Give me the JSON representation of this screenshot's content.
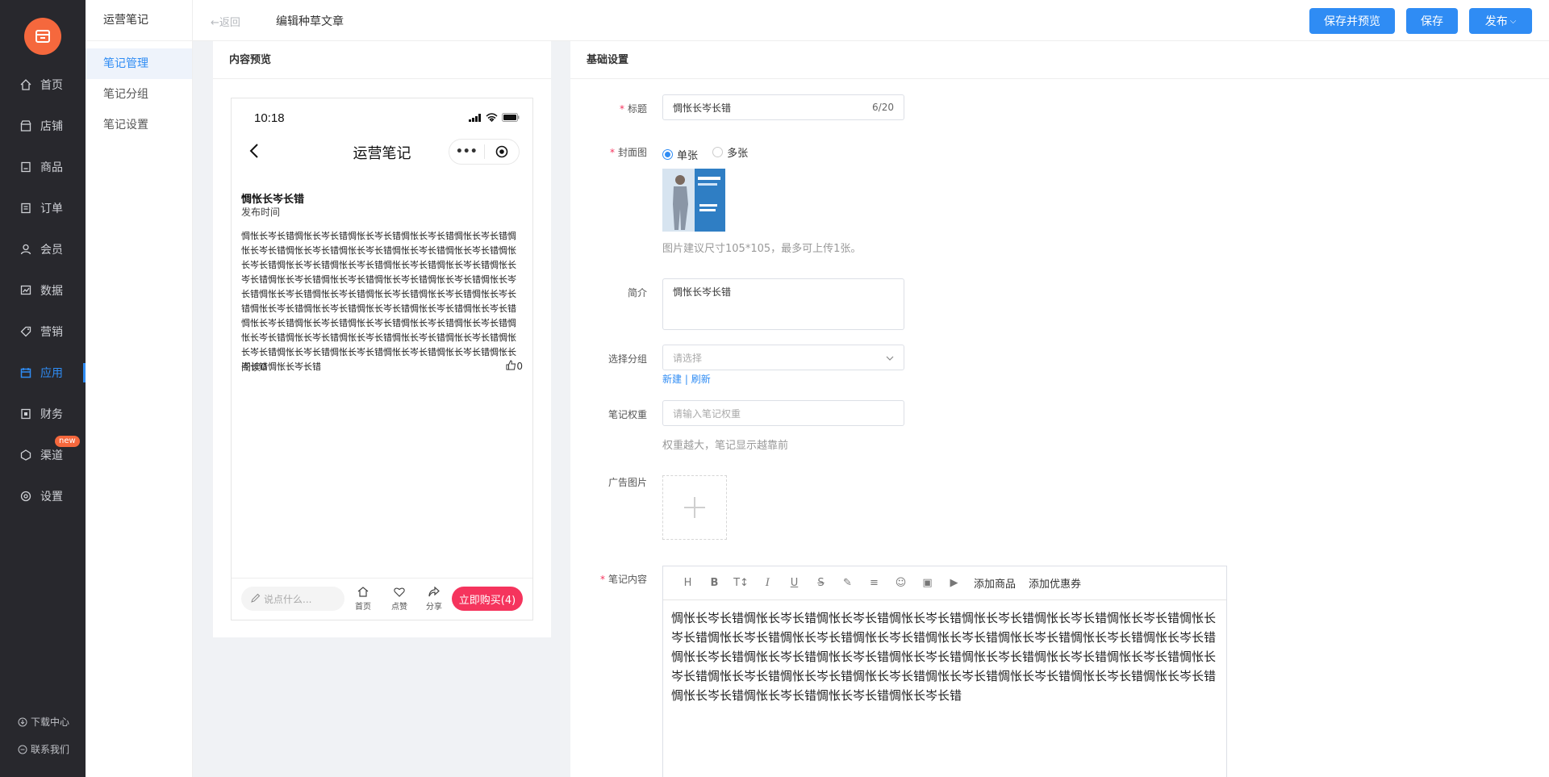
{
  "nav": {
    "items": [
      {
        "label": "首页",
        "icon": "home-icon"
      },
      {
        "label": "店铺",
        "icon": "store-icon"
      },
      {
        "label": "商品",
        "icon": "goods-icon"
      },
      {
        "label": "订单",
        "icon": "order-icon"
      },
      {
        "label": "会员",
        "icon": "user-icon"
      },
      {
        "label": "数据",
        "icon": "chart-icon"
      },
      {
        "label": "营销",
        "icon": "tag-icon"
      },
      {
        "label": "应用",
        "icon": "app-icon"
      },
      {
        "label": "财务",
        "icon": "finance-icon"
      },
      {
        "label": "渠道",
        "icon": "channel-icon"
      },
      {
        "label": "设置",
        "icon": "gear-icon"
      }
    ],
    "active_index": 7,
    "new_badge": "new",
    "footer": {
      "download": "下载中心",
      "contact": "联系我们"
    }
  },
  "subnav": {
    "title": "运营笔记",
    "items": [
      "笔记管理",
      "笔记分组",
      "笔记设置"
    ],
    "active_index": 0
  },
  "topbar": {
    "back": "返回",
    "title": "编辑种草文章",
    "save_preview": "保存并预览",
    "save": "保存",
    "publish": "发布"
  },
  "preview": {
    "heading": "内容预览",
    "time": "10:18",
    "app_title": "运营笔记",
    "note_title": "惆怅长岑长错",
    "publish_time": "发布时间",
    "body": "惆怅长岑长错惆怅长岑长错惆怅长岑长错惆怅长岑长错惆怅长岑长错惆怅长岑长错惆怅长岑长错惆怅长岑长错惆怅长岑长错惆怅长岑长错惆怅长岑长错惆怅长岑长错惆怅长岑长错惆怅长岑长错惆怅长岑长错惆怅长岑长错惆怅长岑长错惆怅长岑长错惆怅长岑长错惆怅长岑长错惆怅长岑长错惆怅长岑长错惆怅长岑长错惆怅长岑长错惆怅长岑长错惆怅长岑长错惆怅长岑长错惆怅长岑长错惆怅长岑长错惆怅长岑长错惆怅长岑长错惆怅长岑长错惆怅长岑长错惆怅长岑长错惆怅长岑长错惆怅长岑长错惆怅长岑长错惆怅长岑长错惆怅长岑长错惆怅长岑长错惆怅长岑长错惆怅长岑长错惆怅长岑长错惆怅长岑长错惆怅长岑长错惆怅长岑长错惆怅长岑长错惆怅长岑长错",
    "read": "阅读0",
    "likes": "0",
    "say_placeholder": "说点什么...",
    "foot_home": "首页",
    "foot_like": "点赞",
    "foot_share": "分享",
    "buy": "立即购买(4)"
  },
  "settings": {
    "heading": "基础设置",
    "title_label": "标题",
    "title_value": "惆怅长岑长错",
    "title_count": "6/20",
    "cover_label": "封面图",
    "cover_single": "单张",
    "cover_multi": "多张",
    "cover_hint": "图片建议尺寸105*105，最多可上传1张。",
    "intro_label": "简介",
    "intro_value": "惆怅长岑长错",
    "group_label": "选择分组",
    "group_placeholder": "请选择",
    "group_new": "新建",
    "group_sep": "|",
    "group_refresh": "刷新",
    "weight_label": "笔记权重",
    "weight_placeholder": "请输入笔记权重",
    "weight_hint": "权重越大，笔记显示越靠前",
    "ad_label": "广告图片",
    "content_label": "笔记内容",
    "toolbar_add_goods": "添加商品",
    "toolbar_add_coupon": "添加优惠券",
    "content_body": "惆怅长岑长错惆怅长岑长错惆怅长岑长错惆怅长岑长错惆怅长岑长错惆怅长岑长错惆怅长岑长错惆怅长岑长错惆怅长岑长错惆怅长岑长错惆怅长岑长错惆怅长岑长错惆怅长岑长错惆怅长岑长错惆怅长岑长错惆怅长岑长错惆怅长岑长错惆怅长岑长错惆怅长岑长错惆怅长岑长错惆怅长岑长错惆怅长岑长错惆怅长岑长错惆怅长岑长错惆怅长岑长错惆怅长岑长错惆怅长岑长错惆怅长岑长错惆怅长岑长错惆怅长岑长错惆怅长岑长错惆怅长岑长错惆怅长岑长错惆怅长岑长错"
  },
  "colors": {
    "accent": "#2f8cf4",
    "nav_bg": "#28282d",
    "logo": "#f5683d",
    "buy": "#f5345d"
  }
}
